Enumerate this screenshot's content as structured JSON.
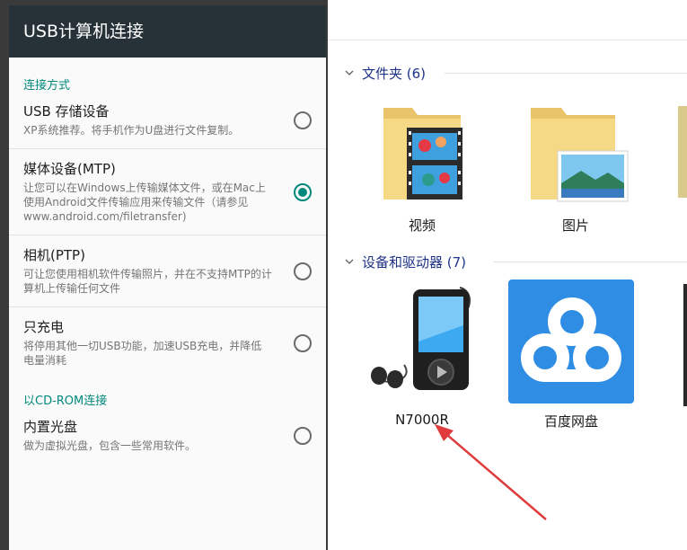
{
  "android": {
    "title": "USB计算机连接",
    "section_connect": "连接方式",
    "options": [
      {
        "title": "USB 存储设备",
        "desc": "XP系统推荐。将手机作为U盘进行文件复制。",
        "selected": false
      },
      {
        "title": "媒体设备(MTP)",
        "desc": "让您可以在Windows上传输媒体文件，或在Mac上使用Android文件传输应用来传输文件（请参见www.android.com/filetransfer)",
        "selected": true
      },
      {
        "title": "相机(PTP)",
        "desc": "可让您使用相机软件传输照片，并在不支持MTP的计算机上传输任何文件",
        "selected": false
      },
      {
        "title": "只充电",
        "desc": "将停用其他一切USB功能，加速USB充电，并降低电量消耗",
        "selected": false
      }
    ],
    "section_cdrom": "以CD-ROM连接",
    "cdrom_option": {
      "title": "内置光盘",
      "desc": "做为虚拟光盘，包含一些常用软件。",
      "selected": false
    },
    "accent_color": "#00897b"
  },
  "explorer": {
    "folders_header": "文件夹 (6)",
    "folders": [
      {
        "label": "视频",
        "icon": "video-folder-icon"
      },
      {
        "label": "图片",
        "icon": "pictures-folder-icon"
      }
    ],
    "devices_header": "设备和驱动器 (7)",
    "devices": [
      {
        "label": "N7000R",
        "icon": "media-player-icon"
      },
      {
        "label": "百度网盘",
        "icon": "baidu-cloud-icon"
      }
    ]
  }
}
